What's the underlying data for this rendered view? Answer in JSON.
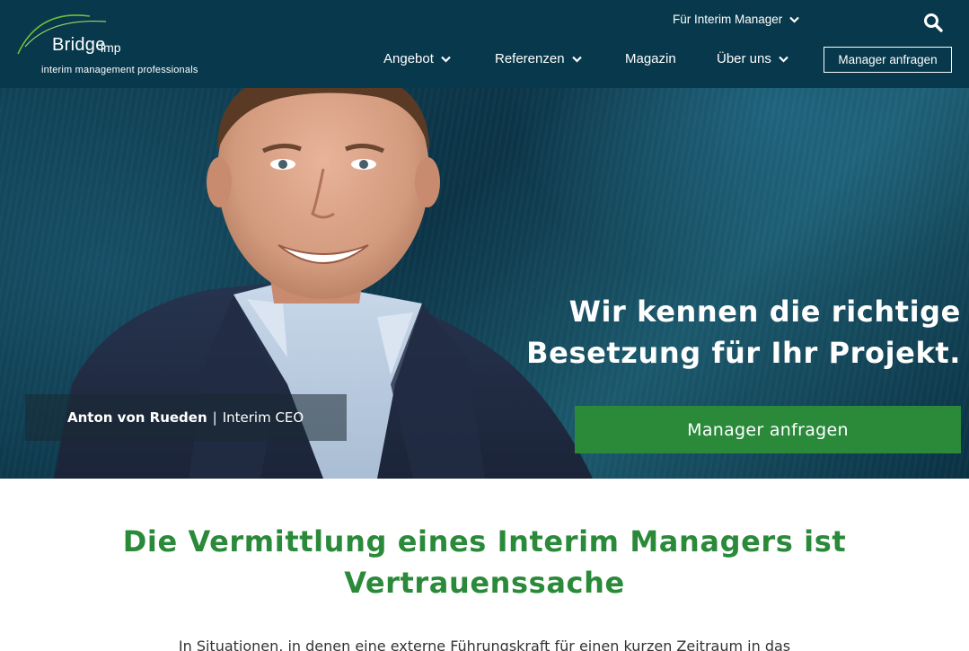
{
  "header": {
    "logo_name": "Bridge",
    "logo_suffix": "imp",
    "logo_tagline": "interim management professionals",
    "top_link": "Für Interim Manager",
    "nav": [
      {
        "label": "Angebot",
        "has_dropdown": true
      },
      {
        "label": "Referenzen",
        "has_dropdown": true
      },
      {
        "label": "Magazin",
        "has_dropdown": false
      },
      {
        "label": "Über uns",
        "has_dropdown": true
      }
    ],
    "cta": "Manager anfragen",
    "colors": {
      "bar": "#07384b",
      "text": "#ffffff"
    }
  },
  "hero": {
    "headline_line1": "Wir kennen die richtige",
    "headline_line2": "Besetzung für Ihr Projekt.",
    "cta": "Manager anfragen",
    "caption_name": "Anton von Rueden",
    "caption_separator": "|",
    "caption_role": "Interim CEO",
    "colors": {
      "cta": "#2a8a3a",
      "background": "#0c3447"
    }
  },
  "intro": {
    "title": "Die Vermittlung eines Interim Managers ist Vertrauenssache",
    "text": "In Situationen, in denen eine externe Führungskraft für einen kurzen Zeitraum in das",
    "colors": {
      "title": "#2a8a3a"
    }
  },
  "icons": [
    "search-icon",
    "chevron-down-icon",
    "logo-arc-icon"
  ]
}
